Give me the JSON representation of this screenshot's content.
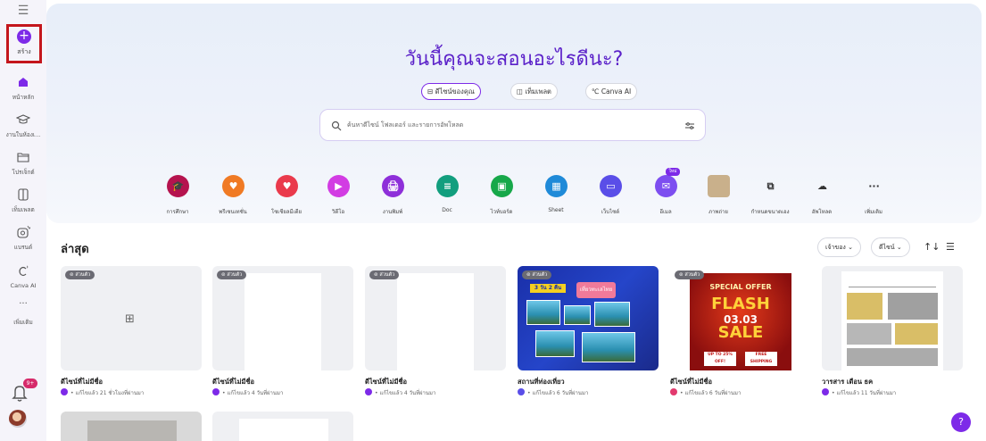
{
  "sidebar": {
    "create_label": "สร้าง",
    "items": [
      {
        "label": "หน้าหลัก",
        "icon": "home-icon"
      },
      {
        "label": "งานในห้องเ...",
        "icon": "graduation-cap-icon"
      },
      {
        "label": "โปรเจ็กต์",
        "icon": "folder-icon"
      },
      {
        "label": "เท็มเพลต",
        "icon": "template-icon"
      },
      {
        "label": "แบรนด์",
        "icon": "brand-icon"
      },
      {
        "label": "Canva AI",
        "icon": "canva-ai-icon"
      },
      {
        "label": "เพิ่มเติม",
        "icon": "more-icon"
      }
    ],
    "notification_count": "9+"
  },
  "hero": {
    "title": "วันนี้คุณจะสอนอะไรดีนะ?",
    "tabs": [
      "ดีไซน์ของคุณ",
      "เท็มเพลต",
      "Canva AI"
    ],
    "search_placeholder": "ค้นหาดีไซน์ โฟลเดอร์ และรายการอัพโหลด"
  },
  "shortcuts": [
    {
      "label": "การศึกษา",
      "color": "#b5134e",
      "glyph": "🎓"
    },
    {
      "label": "พรีเซนเทชั่น",
      "color": "#f07a24",
      "glyph": "♥"
    },
    {
      "label": "โซเชียลมีเดีย",
      "color": "#ea3a4c",
      "glyph": "♥"
    },
    {
      "label": "วิดีโอ",
      "color": "#d23ce3",
      "glyph": "▶"
    },
    {
      "label": "งานพิมพ์",
      "color": "#8e2fd9",
      "glyph": "🖨"
    },
    {
      "label": "Doc",
      "color": "#129e7e",
      "glyph": "≡"
    },
    {
      "label": "ไวท์บอร์ด",
      "color": "#17a84a",
      "glyph": "▣"
    },
    {
      "label": "Sheet",
      "color": "#1f8ad8",
      "glyph": "▦"
    },
    {
      "label": "เว็บไซต์",
      "color": "#5a4ee8",
      "glyph": "▭"
    },
    {
      "label": "อีเมล",
      "color": "#7d4ef0",
      "glyph": "✉",
      "badge": "ใหม่"
    },
    {
      "label": "ภาพถ่าย",
      "color": "#c9b08b",
      "glyph": ""
    },
    {
      "label": "กำหนดขนาดเอง",
      "color": "",
      "glyph": "⧉"
    },
    {
      "label": "อัพโหลด",
      "color": "",
      "glyph": "☁"
    },
    {
      "label": "เพิ่มเติม",
      "color": "",
      "glyph": "···"
    }
  ],
  "recent": {
    "title": "ล่าสุด",
    "owner_filter": "เจ้าของ",
    "type_filter": "ดีไซน์",
    "cards": [
      {
        "owner": "ส่วนตัว",
        "title": "ดีไซน์ที่ไม่มีชื่อ",
        "meta": "• แก้ไขแล้ว 21 ชั่วโมงที่ผ่านมา",
        "thumb": "empty"
      },
      {
        "owner": "ส่วนตัว",
        "title": "ดีไซน์ที่ไม่มีชื่อ",
        "meta": "• แก้ไขแล้ว 4 วันที่ผ่านมา",
        "thumb": "page"
      },
      {
        "owner": "ส่วนตัว",
        "title": "ดีไซน์ที่ไม่มีชื่อ",
        "meta": "• แก้ไขแล้ว 4 วันที่ผ่านมา",
        "thumb": "page"
      },
      {
        "owner": "ส่วนตัว",
        "title": "สถานที่ท่องเที่ยว",
        "meta": "• แก้ไขแล้ว 6 วันที่ผ่านมา",
        "thumb": "travel",
        "thumb_text": [
          "3 วัน 2 คืน",
          "เที่ยวทะเลไทย"
        ]
      },
      {
        "owner": "ส่วนตัว",
        "title": "ดีไซน์ที่ไม่มีชื่อ",
        "meta": "• แก้ไขแล้ว 6 วันที่ผ่านมา",
        "thumb": "flash",
        "thumb_text": [
          "SPECIAL OFFER",
          "FLASH",
          "03.03",
          "SALE",
          "UP TO 25% OFF!",
          "FREE SHIPPING"
        ]
      },
      {
        "owner": "",
        "title": "วารสาร เดือน ธค",
        "meta": "• แก้ไขแล้ว 11 วันที่ผ่านมา",
        "thumb": "doc"
      }
    ]
  },
  "colors": {
    "accent": "#7d2ae8",
    "highlight_box": "#c4161c"
  }
}
